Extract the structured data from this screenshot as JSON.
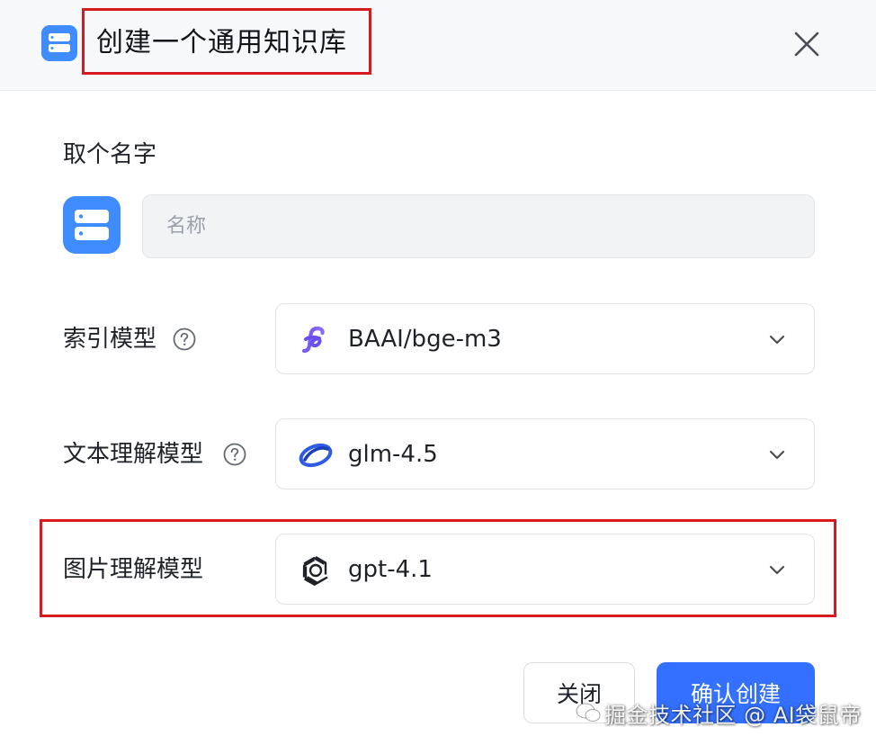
{
  "dialog": {
    "title": "创建一个通用知识库",
    "icon": "database-icon",
    "close_icon": "close-icon",
    "highlight_color": "#d71920"
  },
  "name_section": {
    "label": "取个名字",
    "placeholder": "名称",
    "value": "",
    "icon": "database-icon"
  },
  "fields": [
    {
      "label": "索引模型",
      "has_help": true,
      "help_icon": "help-circle-icon",
      "value": "BAAI/bge-m3",
      "logo": "bge-logo-icon"
    },
    {
      "label": "文本理解模型",
      "has_help": true,
      "help_icon": "help-circle-icon",
      "value": "glm-4.5",
      "logo": "zhipu-logo-icon"
    },
    {
      "label": "图片理解模型",
      "has_help": false,
      "value": "gpt-4.1",
      "logo": "openai-logo-icon",
      "highlighted": true
    }
  ],
  "footer": {
    "close_label": "关闭",
    "confirm_label": "确认创建"
  },
  "watermark": {
    "text": "掘金技术社区 @ AI袋鼠帝",
    "icon": "wechat-icon"
  },
  "colors": {
    "accent": "#3370ff",
    "icon_blue": "#3f8cff",
    "highlight": "#d71920"
  }
}
